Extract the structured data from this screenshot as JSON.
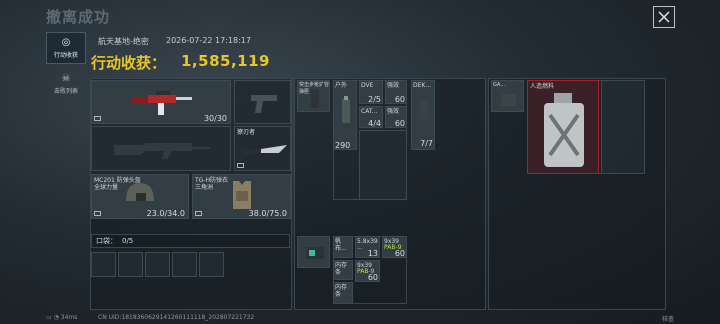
{
  "header": {
    "title": "撤离成功",
    "close_icon": "close-icon"
  },
  "sidebar": {
    "tabs": [
      {
        "label": "行动收获",
        "icon": "target-icon",
        "active": true
      },
      {
        "label": "击败列表",
        "icon": "skull-icon",
        "active": false
      }
    ]
  },
  "info": {
    "location": "航天基地-绝密",
    "timestamp": "2026-07-22 17:18:17",
    "yield_label": "行动收获：",
    "yield_value": "1,585,119"
  },
  "equipment": {
    "primary_weapon": {
      "ammo": "30/30",
      "icon": "rifle-icon"
    },
    "secondary_weapon": {
      "icon": "pistol-icon"
    },
    "long_weapon": {
      "icon": "rifle-silhouette-icon"
    },
    "melee": {
      "label": "獠刃者",
      "icon": "knife-icon"
    },
    "helmet": {
      "name_line1": "MC201 防弹头盔",
      "name_line2": "全球力量",
      "durability": "23.0/34.0",
      "icon": "helmet-icon"
    },
    "armor": {
      "name_line1": "TG-H防弹衣",
      "name_line2": "三角洲",
      "durability": "38.0/75.0",
      "icon": "armor-icon"
    }
  },
  "pockets": {
    "label": "口袋：",
    "value": "0/5"
  },
  "chest_rig": {
    "items": [
      {
        "label": "突击步枪扩容弹匣",
        "icon": "magazine-icon"
      },
      {
        "label": "户外",
        "count": "",
        "icon": "bottle-icon"
      },
      {
        "label": "DVE",
        "count": "2/5",
        "icon": "syringe-icon"
      },
      {
        "label": "强效",
        "count": "60",
        "icon": "syringe-icon"
      },
      {
        "label": "DEK...",
        "count": "7/7",
        "icon": "grenade-icon"
      },
      {
        "label": "CAT...",
        "count": "4/4",
        "icon": "tourniquet-icon"
      },
      {
        "label": "强效",
        "count": "60",
        "icon": "syringe-icon"
      },
      {
        "label": "",
        "count": "290",
        "icon": "ammo-box-icon"
      }
    ]
  },
  "backpack": {
    "items": [
      {
        "label": "",
        "icon": "device-icon"
      },
      {
        "label": "帆布...",
        "icon": "bag-icon"
      },
      {
        "label": "5.8x39",
        "sub": "...",
        "count": "13",
        "icon": "ammo-icon"
      },
      {
        "label": "9x39",
        "sub": "PAB-9",
        "count": "60",
        "icon": "ammo-icon"
      },
      {
        "label": "内存条",
        "icon": "chip-icon"
      },
      {
        "label": "内存条",
        "icon": "chip-icon"
      },
      {
        "label": "9x39",
        "sub": "PAB-9",
        "count": "60",
        "icon": "ammo-icon"
      }
    ]
  },
  "safe_box": {
    "items": [
      {
        "label": "GA...",
        "icon": "box-icon"
      },
      {
        "label": "人造燃料",
        "icon": "fuel-can-icon",
        "highlight": "#a8202a"
      }
    ]
  },
  "status": {
    "ping": "34ms",
    "uid": "CN UID:1818360629141260111118_202807221732",
    "corner": "核查"
  },
  "colors": {
    "accent": "#e8c52a",
    "rare_red": "#a8202a",
    "green_text": "#b4e245"
  }
}
